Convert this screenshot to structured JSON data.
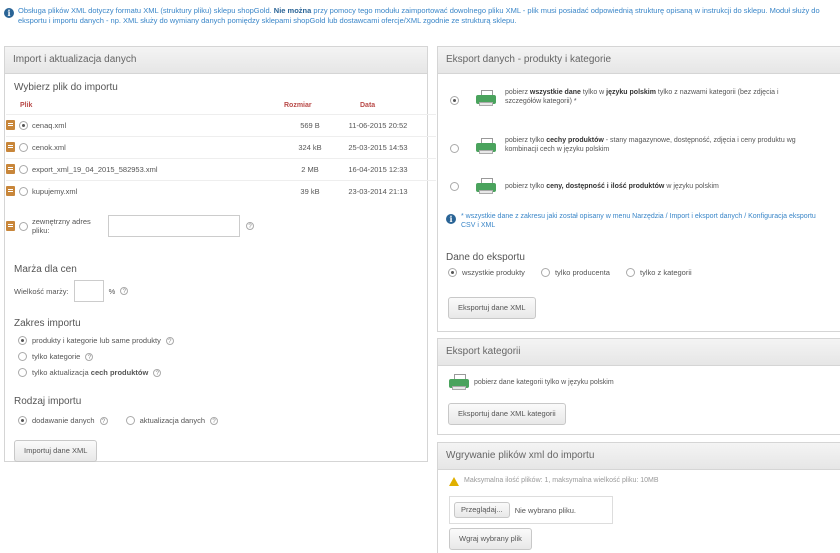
{
  "info_top": {
    "text_a": "Obsługa plików XML dotyczy formatu XML (struktury pliku) sklepu shopGold. ",
    "text_bold": "Nie można",
    "text_b": " przy pomocy tego modułu zaimportować dowolnego pliku XML - plik musi posiadać odpowiednią strukturę opisaną w instrukcji do sklepu. Moduł służy do eksportu i importu danych - np. XML służy do wymiany danych pomiędzy sklepami shopGold lub dostawcami ofercje/XML zgodnie ze strukturą sklepu."
  },
  "import_panel": {
    "title": "Import i aktualizacja danych",
    "choose_title": "Wybierz plik do importu",
    "col_file": "Plik",
    "col_size": "Rozmiar",
    "col_date": "Data",
    "files": [
      {
        "name": "cenaq.xml",
        "size": "569 B",
        "date": "11-06-2015 20:52"
      },
      {
        "name": "cenok.xml",
        "size": "324 kB",
        "date": "25-03-2015 14:53"
      },
      {
        "name": "export_xml_19_04_2015_582953.xml",
        "size": "2 MB",
        "date": "16-04-2015 12:33"
      },
      {
        "name": "kupujemy.xml",
        "size": "39 kB",
        "date": "23-03-2014 21:13"
      }
    ],
    "external_label": "zewnętrzny adres pliku:",
    "margin_title": "Marża dla cen",
    "margin_label": "Wielkość marży:",
    "margin_unit": "%",
    "scope_title": "Zakres importu",
    "scope_opt1": "produkty i kategorie lub same produkty",
    "scope_opt2": "tylko kategorie",
    "scope_opt3_a": "tylko aktualizacja ",
    "scope_opt3_b": "cech produktów",
    "type_title": "Rodzaj importu",
    "type_opt1": "dodawanie danych",
    "type_opt2": "aktualizacja danych",
    "import_button": "Importuj dane XML"
  },
  "export_panel": {
    "title": "Eksport danych - produkty i kategorie",
    "opt1_a": "pobierz ",
    "opt1_bold": "wszystkie dane",
    "opt1_b": " tylko w ",
    "opt1_bold2": "języku polskim",
    "opt1_c": " tylko z nazwami kategorii (bez zdjęcia i szczegółów kategorii) *",
    "opt2_a": "pobierz tylko ",
    "opt2_bold": "cechy produktów",
    "opt2_b": " - stany magazynowe, dostępność, zdjęcia i ceny produktu wg kombinacji cech w języku polskim",
    "opt3_a": "pobierz tylko ",
    "opt3_bold": "ceny, dostępność i ilość produktów",
    "opt3_b": " w języku polskim",
    "note": "* wszystkie dane z zakresu jaki został opisany w menu Narzędzia / Import i eksport danych / Konfiguracja eksportu CSV i XML",
    "data_title": "Dane do eksportu",
    "data_opt1": "wszystkie produkty",
    "data_opt2": "tylko producenta",
    "data_opt3": "tylko z kategorii",
    "export_button": "Eksportuj dane XML"
  },
  "categories_panel": {
    "title": "Eksport kategorii",
    "text": "pobierz dane kategorii tylko w języku polskim",
    "button": "Eksportuj dane XML kategorii"
  },
  "upload_panel": {
    "title": "Wgrywanie plików xml do importu",
    "warning": "Maksymalna ilość plików: 1, maksymalna wielkość pliku: 10MB",
    "browse_button": "Przeglądaj...",
    "no_file": "Nie wybrano pliku.",
    "upload_button": "Wgraj wybrany plik"
  },
  "icons": {
    "info": "info-icon",
    "help": "help-icon",
    "file": "xml-file-icon",
    "export": "printer-icon",
    "warning": "warning-icon"
  },
  "colors": {
    "link_blue": "#3a86c8",
    "header_red": "#b94a48",
    "printer_green": "#4aa35d",
    "warning_yellow": "#e0b000"
  }
}
